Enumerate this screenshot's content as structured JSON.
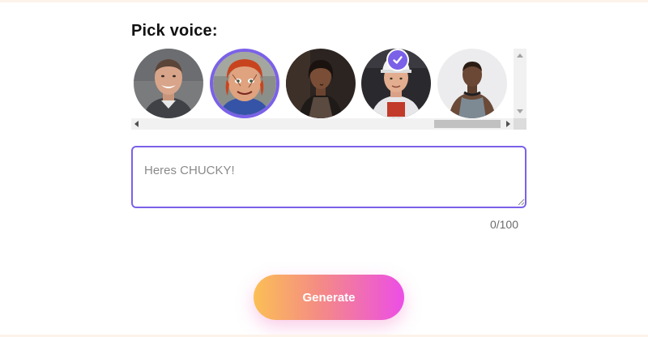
{
  "section_title": "Pick voice:",
  "voices": [
    {
      "icon": "man-smiling-portrait",
      "selected": false
    },
    {
      "icon": "chucky-doll-portrait",
      "selected": true
    },
    {
      "icon": "woman-dark-portrait",
      "selected": false
    },
    {
      "icon": "man-cap-portrait",
      "selected": false
    },
    {
      "icon": "man-tanktop-portrait",
      "selected": false
    }
  ],
  "prompt": {
    "value": "Heres CHUCKY!",
    "counter": "0/100"
  },
  "generate_label": "Generate",
  "colors": {
    "accent": "#7b61e8",
    "gradient_start": "#fbbf55",
    "gradient_end": "#ec4ee6"
  }
}
